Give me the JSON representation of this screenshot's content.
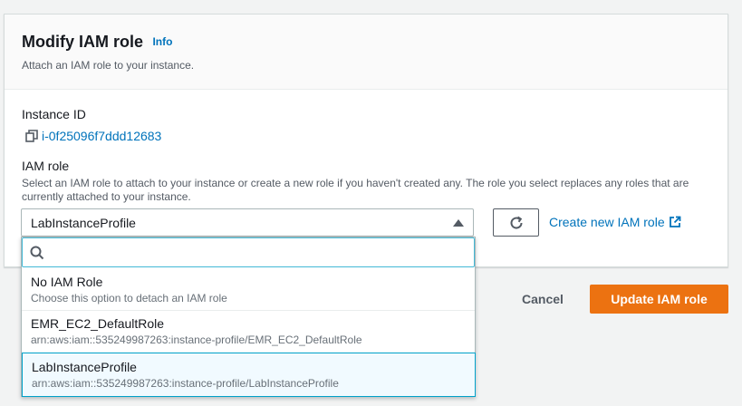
{
  "panel": {
    "title": "Modify IAM role",
    "info_link": "Info",
    "description": "Attach an IAM role to your instance."
  },
  "instance": {
    "label": "Instance ID",
    "value": "i-0f25096f7ddd12683"
  },
  "iam_role": {
    "label": "IAM role",
    "description": "Select an IAM role to attach to your instance or create a new role if you haven't created any. The role you select replaces any roles that are currently attached to your instance.",
    "selected_value": "LabInstanceProfile",
    "search_placeholder": "",
    "create_link": "Create new IAM role",
    "options": [
      {
        "label": "No IAM Role",
        "sub": "Choose this option to detach an IAM role"
      },
      {
        "label": "EMR_EC2_DefaultRole",
        "sub": "arn:aws:iam::535249987263:instance-profile/EMR_EC2_DefaultRole"
      },
      {
        "label": "LabInstanceProfile",
        "sub": "arn:aws:iam::535249987263:instance-profile/LabInstanceProfile"
      }
    ]
  },
  "actions": {
    "cancel_label": "Cancel",
    "update_label": "Update IAM role"
  },
  "icons": {
    "copy": "copy-icon",
    "caret": "caret-up-icon",
    "refresh": "refresh-icon",
    "external": "external-link-icon",
    "search": "search-icon"
  },
  "colors": {
    "link": "#0073bb",
    "primary_button": "#ec7211",
    "selected_option_bg": "#f1faff",
    "focus_border": "#00a1c9"
  }
}
